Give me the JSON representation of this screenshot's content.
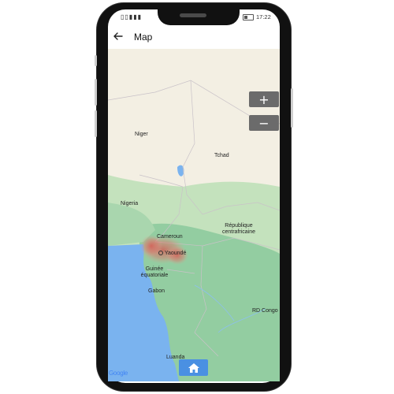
{
  "status_bar": {
    "signal": "▯▯▮▮▮",
    "battery_icon": "battery-icon",
    "time": "17:22"
  },
  "app_bar": {
    "back_icon": "arrow-left-icon",
    "title": "Map"
  },
  "map": {
    "labels": {
      "niger": "Niger",
      "tchad": "Tchad",
      "nigeria": "Nigeria",
      "cameroun": "Cameroun",
      "yaounde": "Yaoundé",
      "rca": "République centrafricaine",
      "guinee": "Guinée équatoriale",
      "gabon": "Gabon",
      "rdc": "RD Congo",
      "luanda": "Luanda"
    },
    "zoom_in_label": "+",
    "zoom_out_label": "−",
    "home_icon": "home-icon",
    "attribution": "Google"
  },
  "colors": {
    "desert": "#f3efe3",
    "vegetation": "#b9dcb4",
    "forest": "#93cda1",
    "water": "#7ab3ef",
    "heatmap": "#d9534f",
    "home_button": "#4a90e2"
  }
}
